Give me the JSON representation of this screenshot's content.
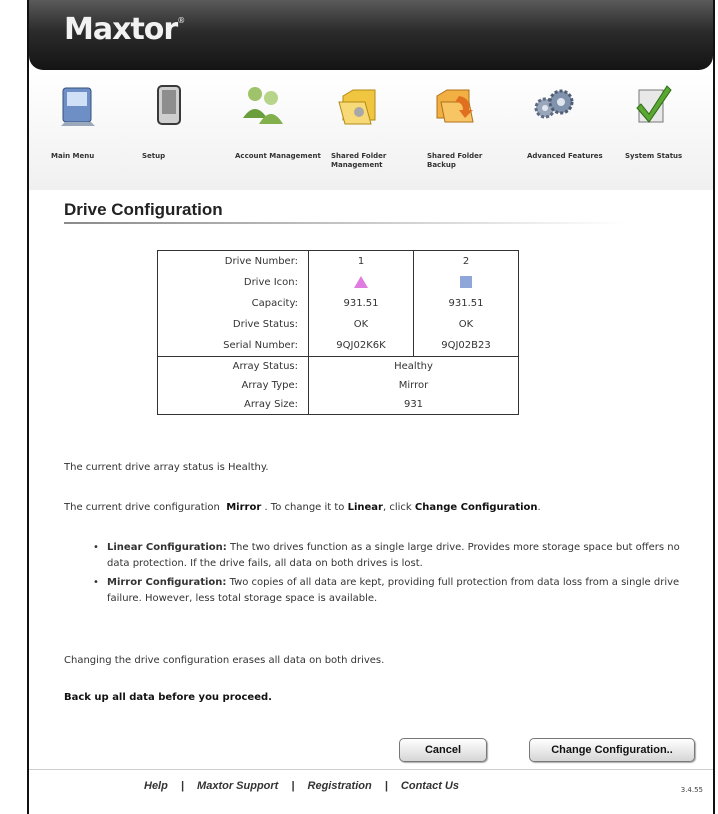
{
  "header": {
    "logo": "Maxtor",
    "logo_mark": "®"
  },
  "nav": [
    {
      "label": "Main Menu",
      "icon": "main-menu-icon"
    },
    {
      "label": "Setup",
      "icon": "setup-icon"
    },
    {
      "label": "Account Management",
      "icon": "account-management-icon"
    },
    {
      "label": "Shared Folder Management",
      "icon": "shared-folder-management-icon"
    },
    {
      "label": "Shared Folder Backup",
      "icon": "shared-folder-backup-icon"
    },
    {
      "label": "Advanced Features",
      "icon": "advanced-features-icon"
    },
    {
      "label": "System Status",
      "icon": "system-status-icon"
    }
  ],
  "page": {
    "title": "Drive Configuration"
  },
  "drive_table": {
    "labels": [
      "Drive Number:",
      "Drive Icon:",
      "Capacity:",
      "Drive Status:",
      "Serial Number:"
    ],
    "drives": [
      {
        "number": "1",
        "icon": "pink-triangle-icon",
        "capacity": "931.51",
        "status": "OK",
        "serial": "9QJ02K6K"
      },
      {
        "number": "2",
        "icon": "blue-square-icon",
        "capacity": "931.51",
        "status": "OK",
        "serial": "9QJ02B23"
      }
    ],
    "array_labels": [
      "Array Status:",
      "Array Type:",
      "Array Size:"
    ],
    "array": {
      "status": "Healthy",
      "type": "Mirror",
      "size": "931"
    }
  },
  "status_text": "The current drive array status is Healthy.",
  "config_text": {
    "prefix": "The current drive configuration",
    "current": "Mirror",
    "mid": ". To change it to",
    "target": "Linear",
    "mid2": ", click",
    "action": "Change Configuration",
    "end": "."
  },
  "bullets": [
    {
      "title": "Linear Configuration:",
      "text": "The two drives function as a single large drive. Provides more storage space but offers no data protection. If the drive fails, all data on both drives is lost."
    },
    {
      "title": "Mirror Configuration:",
      "text": "Two copies of all data are kept, providing full protection from data loss from a single drive failure. However, less total storage space is available."
    }
  ],
  "warning_text": "Changing the drive configuration erases all data on both drives.",
  "backup_text": "Back up all data before you proceed.",
  "buttons": {
    "cancel": "Cancel",
    "change": "Change Configuration.."
  },
  "footer": {
    "help": "Help",
    "support": "Maxtor Support",
    "registration": "Registration",
    "contact": "Contact Us",
    "sep": "|",
    "version": "3.4.55"
  },
  "colors": {
    "header_dark": "#1e1e1e",
    "drive1": "#e07be0",
    "drive2": "#8fa6d9"
  }
}
